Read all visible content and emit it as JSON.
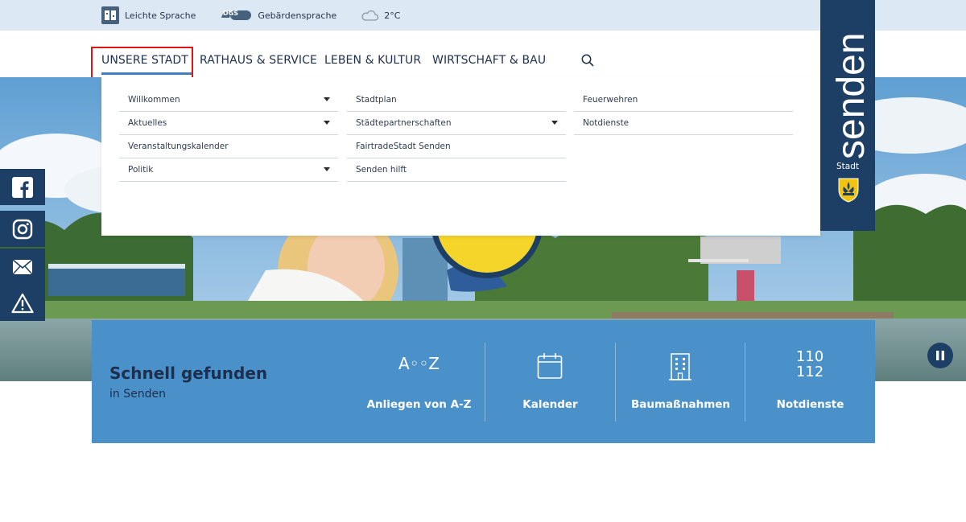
{
  "topbar": {
    "easy_language": "Leichte Sprache",
    "sign_language_badge": "DGS",
    "sign_language": "Gebärdensprache",
    "weather": "2°C"
  },
  "nav": {
    "items": [
      {
        "label": "UNSERE STADT"
      },
      {
        "label": "RATHAUS & SERVICE"
      },
      {
        "label": "LEBEN & KULTUR"
      },
      {
        "label": "WIRTSCHAFT & BAU"
      }
    ]
  },
  "dropdown": {
    "col1": [
      "Willkommen",
      "Aktuelles",
      "Veranstaltungskalender",
      "Politik"
    ],
    "col2": [
      "Stadtplan",
      "Städtepartnerschaften",
      "FairtradeStadt Senden",
      "Senden hilft"
    ],
    "col3": [
      "Feuerwehren",
      "Notdienste"
    ]
  },
  "logo": {
    "name": "senden",
    "subtitle": "Stadt"
  },
  "quick": {
    "title": "Schnell gefunden",
    "subtitle": "in Senden",
    "az_icon_text": "A◦◦Z",
    "emergency_line1": "110",
    "emergency_line2": "112",
    "items": [
      {
        "label": "Anliegen von A-Z"
      },
      {
        "label": "Kalender"
      },
      {
        "label": "Baumaßnahmen"
      },
      {
        "label": "Notdienste"
      }
    ]
  },
  "colors": {
    "navy": "#1d3f66",
    "quick_blue": "#4a91c9",
    "topbar": "#dce8f4",
    "highlight": "#e11414"
  }
}
